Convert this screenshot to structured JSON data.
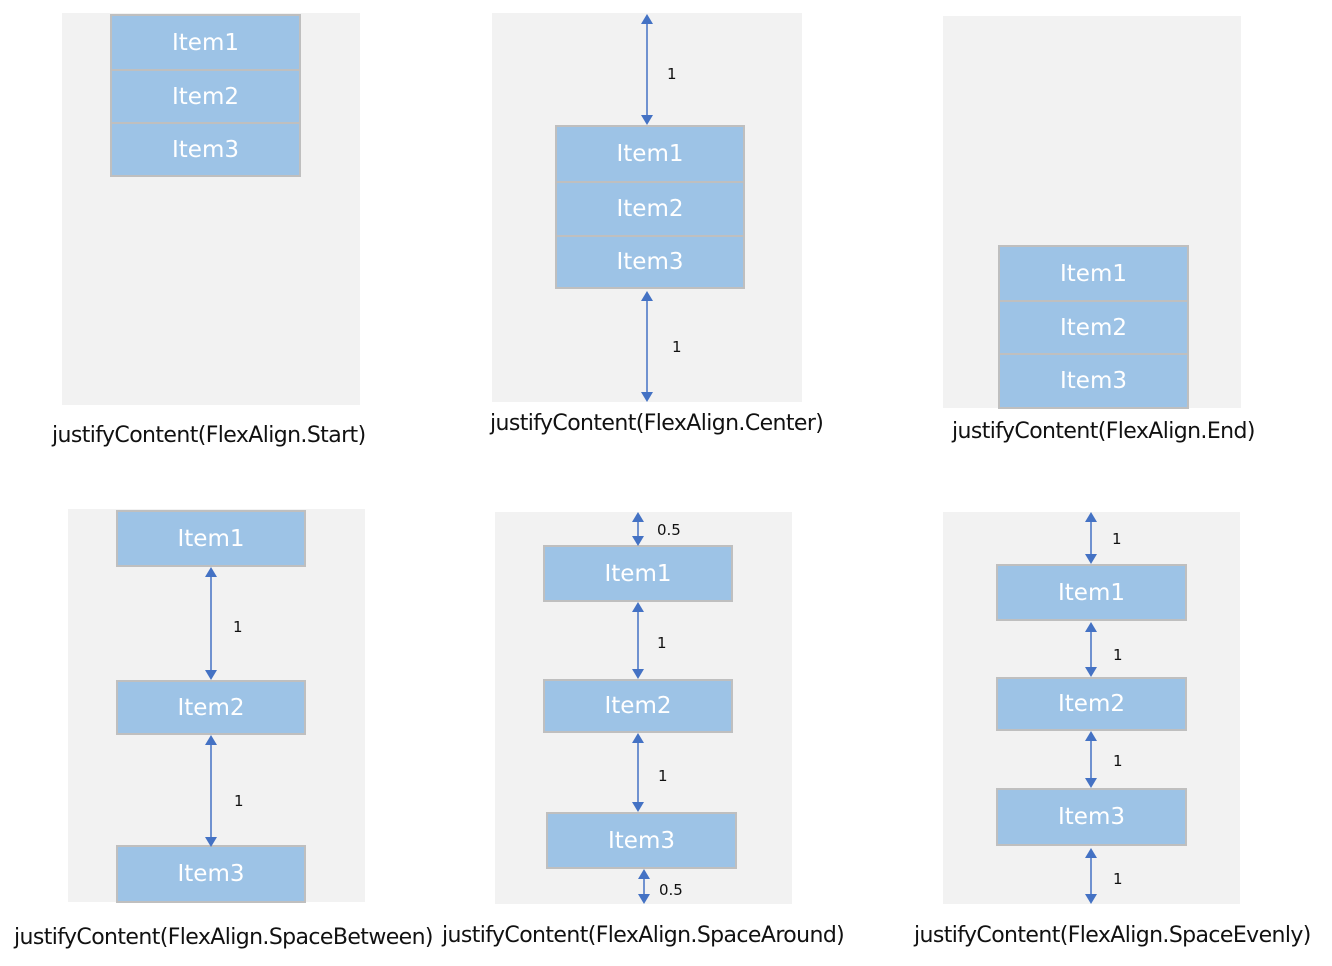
{
  "diagrams": [
    {
      "caption": "justifyContent(FlexAlign.Start)",
      "items": [
        "Item1",
        "Item2",
        "Item3"
      ],
      "gaps": []
    },
    {
      "caption": "justifyContent(FlexAlign.Center)",
      "items": [
        "Item1",
        "Item2",
        "Item3"
      ],
      "gaps": [
        "1",
        "1"
      ]
    },
    {
      "caption": "justifyContent(FlexAlign.End)",
      "items": [
        "Item1",
        "Item2",
        "Item3"
      ],
      "gaps": []
    },
    {
      "caption": "justifyContent(FlexAlign.SpaceBetween)",
      "items": [
        "Item1",
        "Item2",
        "Item3"
      ],
      "gaps": [
        "1",
        "1"
      ]
    },
    {
      "caption": "justifyContent(FlexAlign.SpaceAround)",
      "items": [
        "Item1",
        "Item2",
        "Item3"
      ],
      "gaps": [
        "0.5",
        "1",
        "1",
        "0.5"
      ]
    },
    {
      "caption": "justifyContent(FlexAlign.SpaceEvenly)",
      "items": [
        "Item1",
        "Item2",
        "Item3"
      ],
      "gaps": [
        "1",
        "1",
        "1",
        "1"
      ]
    }
  ],
  "colors": {
    "panel": "#f2f2f2",
    "item_fill": "#9dc3e6",
    "item_border": "#bfbfbf",
    "arrow": "#4472c4"
  }
}
